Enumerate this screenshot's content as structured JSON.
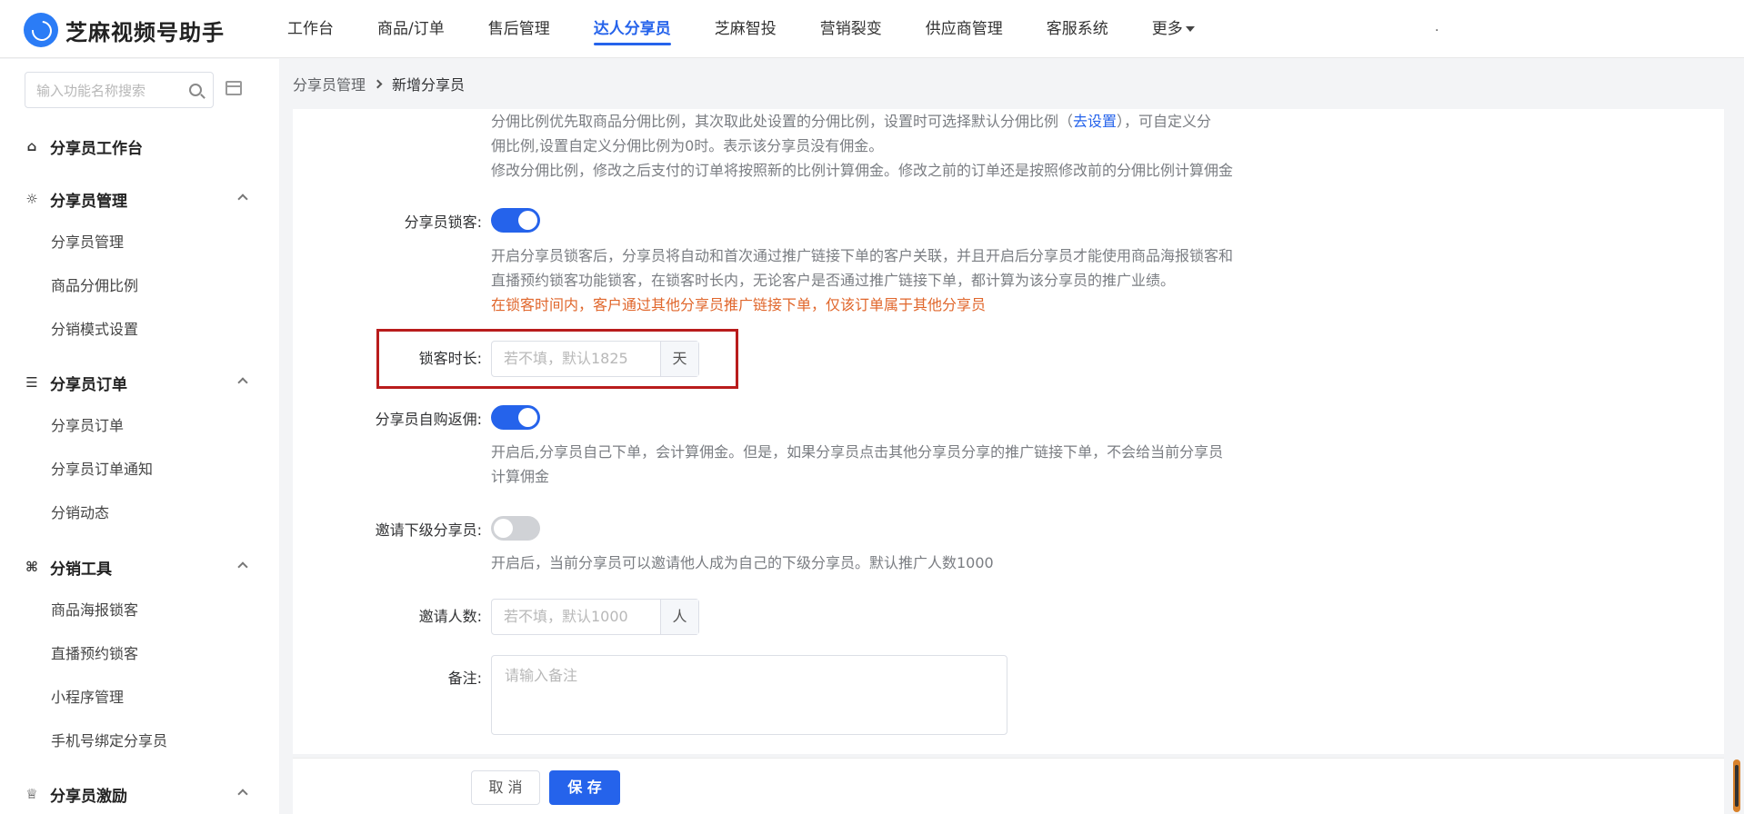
{
  "app": {
    "title": "芝麻视频号助手"
  },
  "nav": {
    "items": [
      "工作台",
      "商品/订单",
      "售后管理",
      "达人分享员",
      "芝麻智投",
      "营销裂变",
      "供应商管理",
      "客服系统"
    ],
    "more": "更多",
    "active_index": 3,
    "right_text": "."
  },
  "sidebar": {
    "search_placeholder": "输入功能名称搜索",
    "top_item": "分享员工作台",
    "groups": [
      {
        "title": "分享员管理",
        "items": [
          "分享员管理",
          "商品分佣比例",
          "分销模式设置"
        ]
      },
      {
        "title": "分享员订单",
        "items": [
          "分享员订单",
          "分享员订单通知",
          "分销动态"
        ]
      },
      {
        "title": "分销工具",
        "items": [
          "商品海报锁客",
          "直播预约锁客",
          "小程序管理",
          "手机号绑定分享员"
        ]
      },
      {
        "title": "分享员激励",
        "items": []
      }
    ]
  },
  "breadcrumb": {
    "parent": "分享员管理",
    "current": "新增分享员"
  },
  "form": {
    "commission_desc_1a": "分佣比例优先取商品分佣比例，其次取此处设置的分佣比例，设置时可选择默认分佣比例（",
    "commission_desc_link": "去设置",
    "commission_desc_1b": "），可自定义分",
    "commission_desc_2": "佣比例,设置自定义分佣比例为0时。表示该分享员没有佣金。",
    "commission_desc_3": "修改分佣比例，修改之后支付的订单将按照新的比例计算佣金。修改之前的订单还是按照修改前的分佣比例计算佣金",
    "lock_label": "分享员锁客:",
    "lock_on": true,
    "lock_desc_1": "开启分享员锁客后，分享员将自动和首次通过推广链接下单的客户关联，并且开启后分享员才能使用商品海报锁客和",
    "lock_desc_2": "直播预约锁客功能锁客，在锁客时长内，无论客户是否通过推广链接下单，都计算为该分享员的推广业绩。",
    "lock_warn": "在锁客时间内，客户通过其他分享员推广链接下单，仅该订单属于其他分享员",
    "duration_label": "锁客时长:",
    "duration_placeholder": "若不填，默认1825",
    "duration_unit": "天",
    "self_label": "分享员自购返佣:",
    "self_on": true,
    "self_desc_1": "开启后,分享员自己下单，会计算佣金。但是，如果分享员点击其他分享员分享的推广链接下单，不会给当前分享员",
    "self_desc_2": "计算佣金",
    "invite_label": "邀请下级分享员:",
    "invite_on": false,
    "invite_desc": "开启后，当前分享员可以邀请他人成为自己的下级分享员。默认推广人数1000",
    "invite_count_label": "邀请人数:",
    "invite_count_placeholder": "若不填，默认1000",
    "invite_count_unit": "人",
    "remark_label": "备注:",
    "remark_placeholder": "请输入备注"
  },
  "footer": {
    "cancel": "取 消",
    "save": "保 存"
  },
  "colors": {
    "primary": "#2563eb",
    "warning": "#e0662b",
    "highlight": "#b91c1c"
  }
}
